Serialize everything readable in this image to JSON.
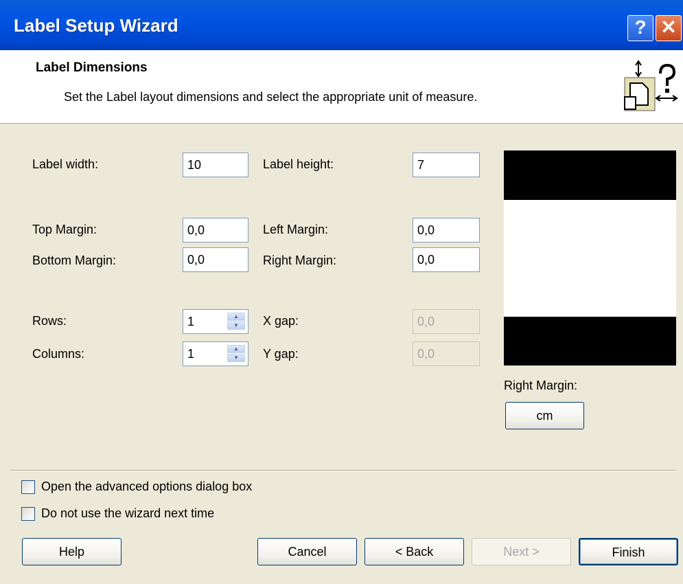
{
  "window": {
    "title": "Label Setup Wizard",
    "help_glyph": "?",
    "close_glyph": "✕"
  },
  "header": {
    "title": "Label Dimensions",
    "subtitle": "Set the Label layout dimensions and select the appropriate unit of measure.",
    "icon": "label-dimensions-icon"
  },
  "form": {
    "label_width": {
      "label": "Label width:",
      "value": "10"
    },
    "label_height": {
      "label": "Label height:",
      "value": "7"
    },
    "top_margin": {
      "label": "Top Margin:",
      "value": "0,0"
    },
    "left_margin": {
      "label": "Left Margin:",
      "value": "0,0"
    },
    "bottom_margin": {
      "label": "Bottom Margin:",
      "value": "0,0"
    },
    "right_margin": {
      "label": "Right Margin:",
      "value": "0,0"
    },
    "rows": {
      "label": "Rows:",
      "value": "1"
    },
    "columns": {
      "label": "Columns:",
      "value": "1"
    },
    "x_gap": {
      "label": "X gap:",
      "value": "0,0"
    },
    "y_gap": {
      "label": "Y gap:",
      "value": "0,0"
    }
  },
  "preview": {
    "caption": "Right Margin:",
    "unit_button": "cm"
  },
  "options": {
    "advanced": {
      "label": "Open the advanced options dialog box",
      "checked": false
    },
    "no_wizard": {
      "label": "Do not use the wizard next time",
      "checked": false
    }
  },
  "buttons": {
    "help": "Help",
    "cancel": "Cancel",
    "back": "< Back",
    "next": "Next >",
    "finish": "Finish"
  },
  "colors": {
    "titlebar": "#0054E3",
    "dialog_bg": "#ECE9D8",
    "preview_border": "#000000"
  }
}
